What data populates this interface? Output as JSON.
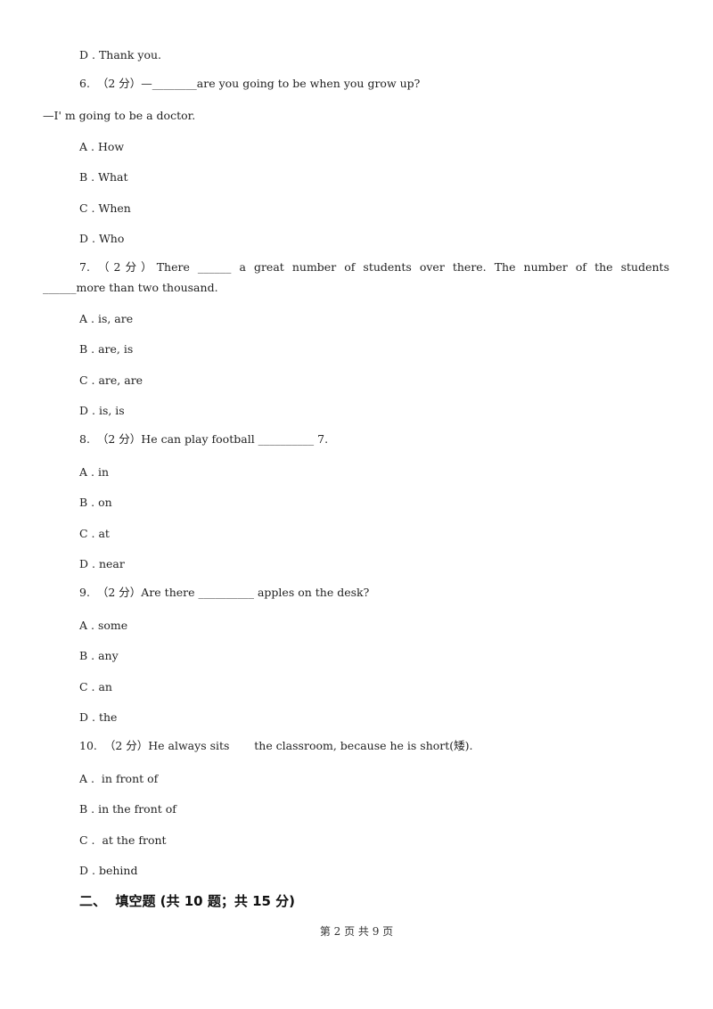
{
  "prev_option": "D . Thank you.",
  "questions": [
    {
      "stem": "6.  （2 分）—________are you going to be when you grow up?",
      "extra": "—I' m going to be a doctor.",
      "options": [
        "A . How",
        "B . What",
        "C . When",
        "D . Who"
      ]
    },
    {
      "stem_line1": "7.  （2分）There ______ a great number of students over there. The number of the students",
      "stem_line2": "______more than two thousand.",
      "options": [
        "A . is, are",
        "B . are, is",
        "C . are, are",
        "D . is, is"
      ]
    },
    {
      "stem": "8.  （2 分）He can play football __________ 7.",
      "options": [
        "A . in",
        "B . on",
        "C . at",
        "D . near"
      ]
    },
    {
      "stem": "9.  （2 分）Are there __________ apples on the desk?",
      "options": [
        "A . some",
        "B . any",
        "C . an",
        "D . the"
      ]
    },
    {
      "stem": "10.  （2 分）He always sits       the classroom, because he is short(矮).",
      "options": [
        "A .  in front of",
        "B . in the front of",
        "C .  at the front",
        "D . behind"
      ]
    }
  ],
  "section_heading": "二、  填空题 (共 10 题；共 15 分)",
  "footer": "第 2 页 共 9 页"
}
